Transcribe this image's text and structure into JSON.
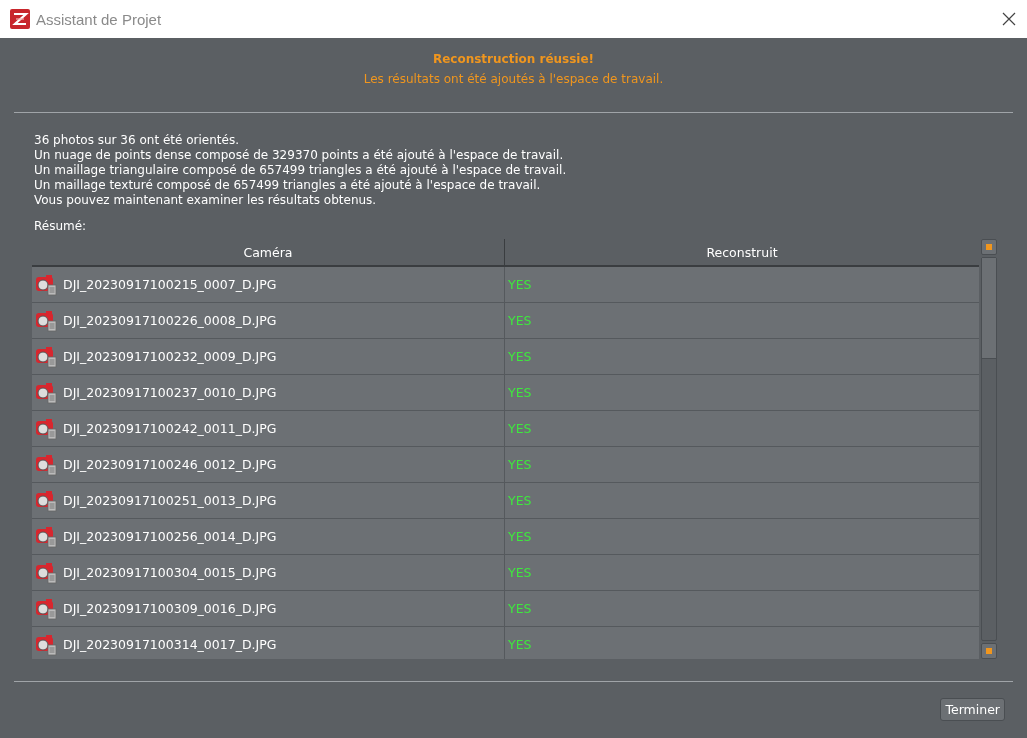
{
  "window": {
    "title": "Assistant de Projet"
  },
  "banner": {
    "heading": "Reconstruction réussie!",
    "subtitle": "Les résultats ont été ajoutés à l'espace de travail."
  },
  "messages": [
    "36 photos sur 36 ont été orientés.",
    "Un nuage de points dense composé de 329370 points a été ajouté à l'espace de travail.",
    "Un maillage triangulaire composé de 657499 triangles a été ajouté à l'espace de travail.",
    "Un maillage texturé composé de 657499 triangles a été ajouté à l'espace de travail.",
    "Vous pouvez maintenant examiner les résultats obtenus."
  ],
  "summary_label": "Résumé:",
  "table": {
    "columns": [
      "Caméra",
      "Reconstruit"
    ],
    "rows": [
      {
        "camera": "DJI_20230917100215_0007_D.JPG",
        "reconstructed": "YES"
      },
      {
        "camera": "DJI_20230917100226_0008_D.JPG",
        "reconstructed": "YES"
      },
      {
        "camera": "DJI_20230917100232_0009_D.JPG",
        "reconstructed": "YES"
      },
      {
        "camera": "DJI_20230917100237_0010_D.JPG",
        "reconstructed": "YES"
      },
      {
        "camera": "DJI_20230917100242_0011_D.JPG",
        "reconstructed": "YES"
      },
      {
        "camera": "DJI_20230917100246_0012_D.JPG",
        "reconstructed": "YES"
      },
      {
        "camera": "DJI_20230917100251_0013_D.JPG",
        "reconstructed": "YES"
      },
      {
        "camera": "DJI_20230917100256_0014_D.JPG",
        "reconstructed": "YES"
      },
      {
        "camera": "DJI_20230917100304_0015_D.JPG",
        "reconstructed": "YES"
      },
      {
        "camera": "DJI_20230917100309_0016_D.JPG",
        "reconstructed": "YES"
      },
      {
        "camera": "DJI_20230917100314_0017_D.JPG",
        "reconstructed": "YES"
      }
    ]
  },
  "buttons": [
    "Terminer"
  ]
}
